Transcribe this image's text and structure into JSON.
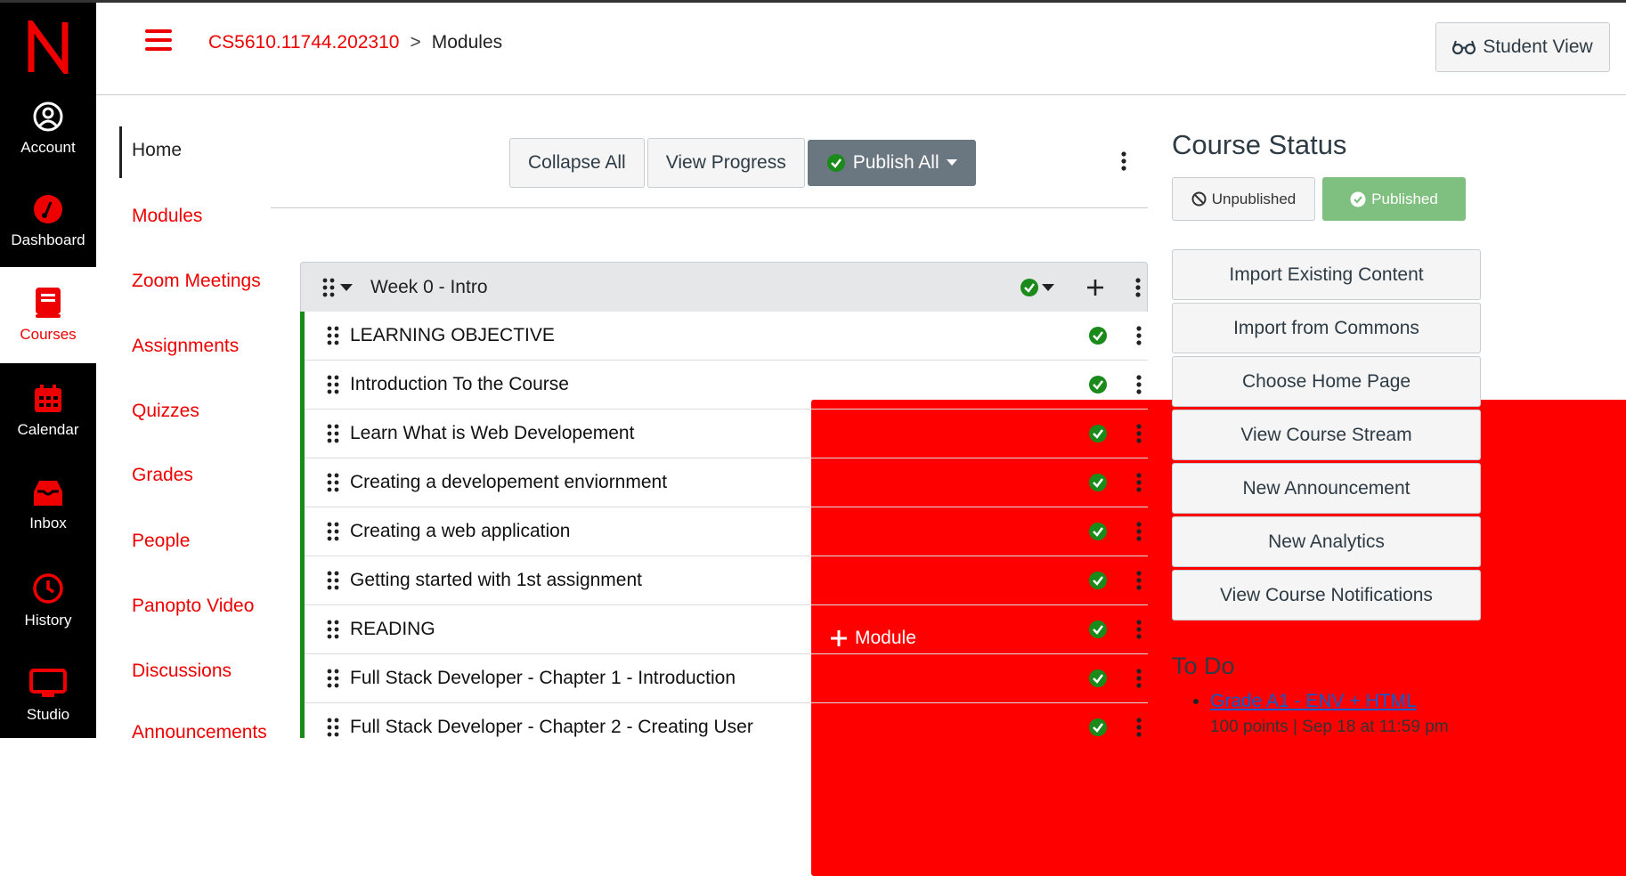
{
  "global_nav": {
    "logo": "N",
    "items": [
      {
        "label": "Account",
        "icon": "account-icon"
      },
      {
        "label": "Dashboard",
        "icon": "dashboard-icon"
      },
      {
        "label": "Courses",
        "icon": "courses-icon"
      },
      {
        "label": "Calendar",
        "icon": "calendar-icon"
      },
      {
        "label": "Inbox",
        "icon": "inbox-icon"
      },
      {
        "label": "History",
        "icon": "history-icon"
      },
      {
        "label": "Studio",
        "icon": "studio-icon"
      }
    ]
  },
  "header": {
    "breadcrumb_course": "CS5610.11744.202310",
    "breadcrumb_sep": ">",
    "breadcrumb_current": "Modules",
    "student_view": "Student View"
  },
  "course_nav": {
    "items": [
      "Home",
      "Modules",
      "Zoom Meetings",
      "Assignments",
      "Quizzes",
      "Grades",
      "People",
      "Panopto Video",
      "Discussions",
      "Announcements"
    ]
  },
  "toolbar": {
    "collapse_all": "Collapse All",
    "view_progress": "View Progress",
    "publish_all": "Publish All",
    "add_module": "Module"
  },
  "module": {
    "title": "Week 0 - Intro",
    "items": [
      "LEARNING OBJECTIVE",
      "Introduction To the Course",
      "Learn What is Web Developement",
      "Creating a developement enviornment",
      "Creating a web application",
      "Getting started with 1st assignment",
      "READING",
      "Full Stack Developer - Chapter 1 - Introduction",
      "Full Stack Developer - Chapter 2 - Creating User"
    ]
  },
  "course_status": {
    "title": "Course Status",
    "unpublished": "Unpublished",
    "published": "Published",
    "actions": [
      "Import Existing Content",
      "Import from Commons",
      "Choose Home Page",
      "View Course Stream",
      "New Announcement",
      "New Analytics",
      "View Course Notifications"
    ]
  },
  "todo": {
    "title": "To Do",
    "items": [
      {
        "link": "Grade A1 - ENV + HTML",
        "detail": "100 points | Sep 18 at 11:59 pm"
      }
    ]
  },
  "colors": {
    "brand": "#ff0000",
    "nav_bg": "#000000",
    "published_green": "#1a8a1a"
  }
}
